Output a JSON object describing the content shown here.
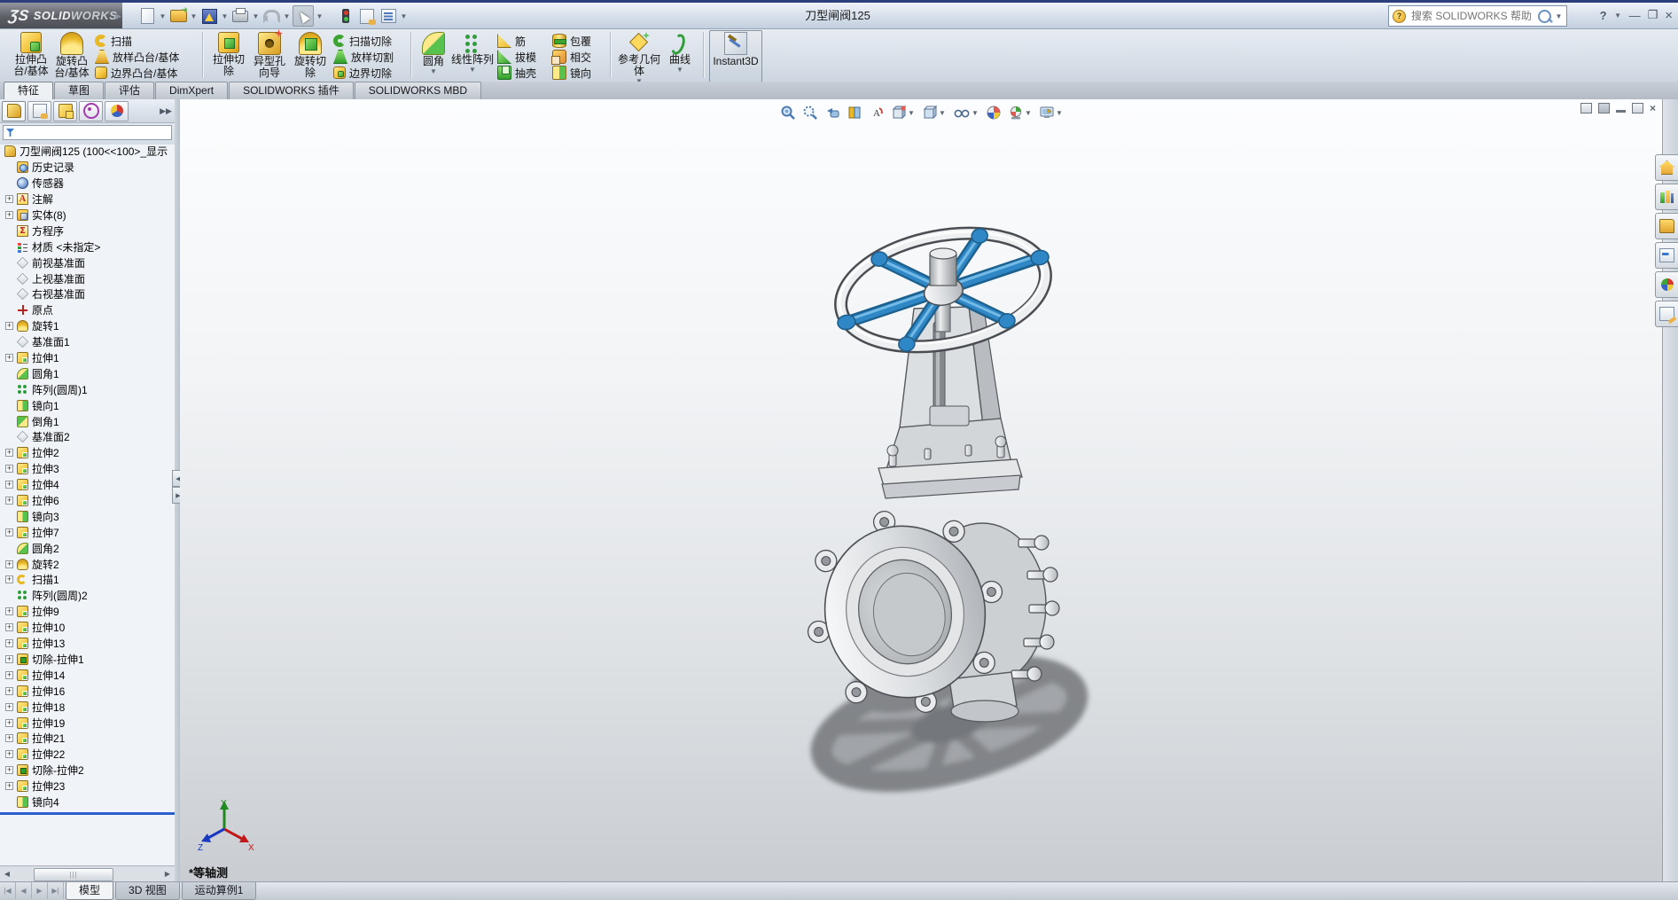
{
  "titlebar": {
    "logo_mark": "ƷS",
    "logo_bold": "SOLID",
    "logo_light": "WORKS",
    "title": "刀型闸阀125",
    "search_placeholder": "搜索 SOLIDWORKS 帮助",
    "help_glyph": "?"
  },
  "ribbon": {
    "g1_big1": "拉伸凸台/基体",
    "g1_big2": "旋转凸台/基体",
    "g1_s1": "扫描",
    "g1_s2": "放样凸台/基体",
    "g1_s3": "边界凸台/基体",
    "g2_big1": "拉伸切除",
    "g2_big2": "异型孔向导",
    "g2_big3": "旋转切除",
    "g2_s1": "扫描切除",
    "g2_s2": "放样切割",
    "g2_s3": "边界切除",
    "g3_big1": "圆角",
    "g3_big2": "线性阵列",
    "g3_a1": "筋",
    "g3_a2": "拔模",
    "g3_a3": "抽壳",
    "g3_b1": "包覆",
    "g3_b2": "相交",
    "g3_b3": "镜向",
    "g4_big1": "参考几何体",
    "g4_big2": "曲线",
    "g5_big1": "Instant3D"
  },
  "tabs": {
    "t1": "特征",
    "t2": "草图",
    "t3": "评估",
    "t4": "DimXpert",
    "t5": "SOLIDWORKS 插件",
    "t6": "SOLIDWORKS MBD"
  },
  "tree": {
    "root": "刀型闸阀125  (100<<100>_显示",
    "items": [
      {
        "label": "历史记录",
        "icon": "history",
        "plus": false
      },
      {
        "label": "传感器",
        "icon": "sensor",
        "plus": false
      },
      {
        "label": "注解",
        "icon": "ann",
        "plus": true
      },
      {
        "label": "实体(8)",
        "icon": "bodies",
        "plus": true
      },
      {
        "label": "方程序",
        "icon": "eq",
        "plus": false
      },
      {
        "label": "材质 <未指定>",
        "icon": "material",
        "plus": false
      },
      {
        "label": "前视基准面",
        "icon": "plane",
        "plus": false
      },
      {
        "label": "上视基准面",
        "icon": "plane",
        "plus": false
      },
      {
        "label": "右视基准面",
        "icon": "plane",
        "plus": false
      },
      {
        "label": "原点",
        "icon": "origin",
        "plus": false
      },
      {
        "label": "旋转1",
        "icon": "revolve",
        "plus": true
      },
      {
        "label": "基准面1",
        "icon": "plane",
        "plus": false
      },
      {
        "label": "拉伸1",
        "icon": "extrude",
        "plus": true
      },
      {
        "label": "圆角1",
        "icon": "fillet",
        "plus": false
      },
      {
        "label": "阵列(圆周)1",
        "icon": "pattern",
        "plus": false
      },
      {
        "label": "镜向1",
        "icon": "mirror",
        "plus": false
      },
      {
        "label": "倒角1",
        "icon": "chamfer",
        "plus": false
      },
      {
        "label": "基准面2",
        "icon": "plane",
        "plus": false
      },
      {
        "label": "拉伸2",
        "icon": "extrude",
        "plus": true
      },
      {
        "label": "拉伸3",
        "icon": "extrude",
        "plus": true
      },
      {
        "label": "拉伸4",
        "icon": "extrude",
        "plus": true
      },
      {
        "label": "拉伸6",
        "icon": "extrude",
        "plus": true
      },
      {
        "label": "镜向3",
        "icon": "mirror",
        "plus": false
      },
      {
        "label": "拉伸7",
        "icon": "extrude",
        "plus": true
      },
      {
        "label": "圆角2",
        "icon": "fillet",
        "plus": false
      },
      {
        "label": "旋转2",
        "icon": "revolve",
        "plus": true
      },
      {
        "label": "扫描1",
        "icon": "sweep",
        "plus": true
      },
      {
        "label": "阵列(圆周)2",
        "icon": "pattern",
        "plus": false
      },
      {
        "label": "拉伸9",
        "icon": "extrude",
        "plus": true
      },
      {
        "label": "拉伸10",
        "icon": "extrude",
        "plus": true
      },
      {
        "label": "拉伸13",
        "icon": "extrude",
        "plus": true
      },
      {
        "label": "切除-拉伸1",
        "icon": "cut",
        "plus": true
      },
      {
        "label": "拉伸14",
        "icon": "extrude",
        "plus": true
      },
      {
        "label": "拉伸16",
        "icon": "extrude",
        "plus": true
      },
      {
        "label": "拉伸18",
        "icon": "extrude",
        "plus": true
      },
      {
        "label": "拉伸19",
        "icon": "extrude",
        "plus": true
      },
      {
        "label": "拉伸21",
        "icon": "extrude",
        "plus": true
      },
      {
        "label": "拉伸22",
        "icon": "extrude",
        "plus": true
      },
      {
        "label": "切除-拉伸2",
        "icon": "cut",
        "plus": true
      },
      {
        "label": "拉伸23",
        "icon": "extrude",
        "plus": true
      },
      {
        "label": "镜向4",
        "icon": "mirror",
        "plus": false
      }
    ]
  },
  "viewport": {
    "orientation_label": "*等轴测",
    "triad_x": "X",
    "triad_y": "Y",
    "triad_z": "Z"
  },
  "doc_tabs": {
    "t1": "模型",
    "t2": "3D 视图",
    "t3": "运动算例1"
  },
  "colors": {
    "handwheel_blue": "#2f87c6",
    "rollback_blue": "#2b5fce"
  }
}
